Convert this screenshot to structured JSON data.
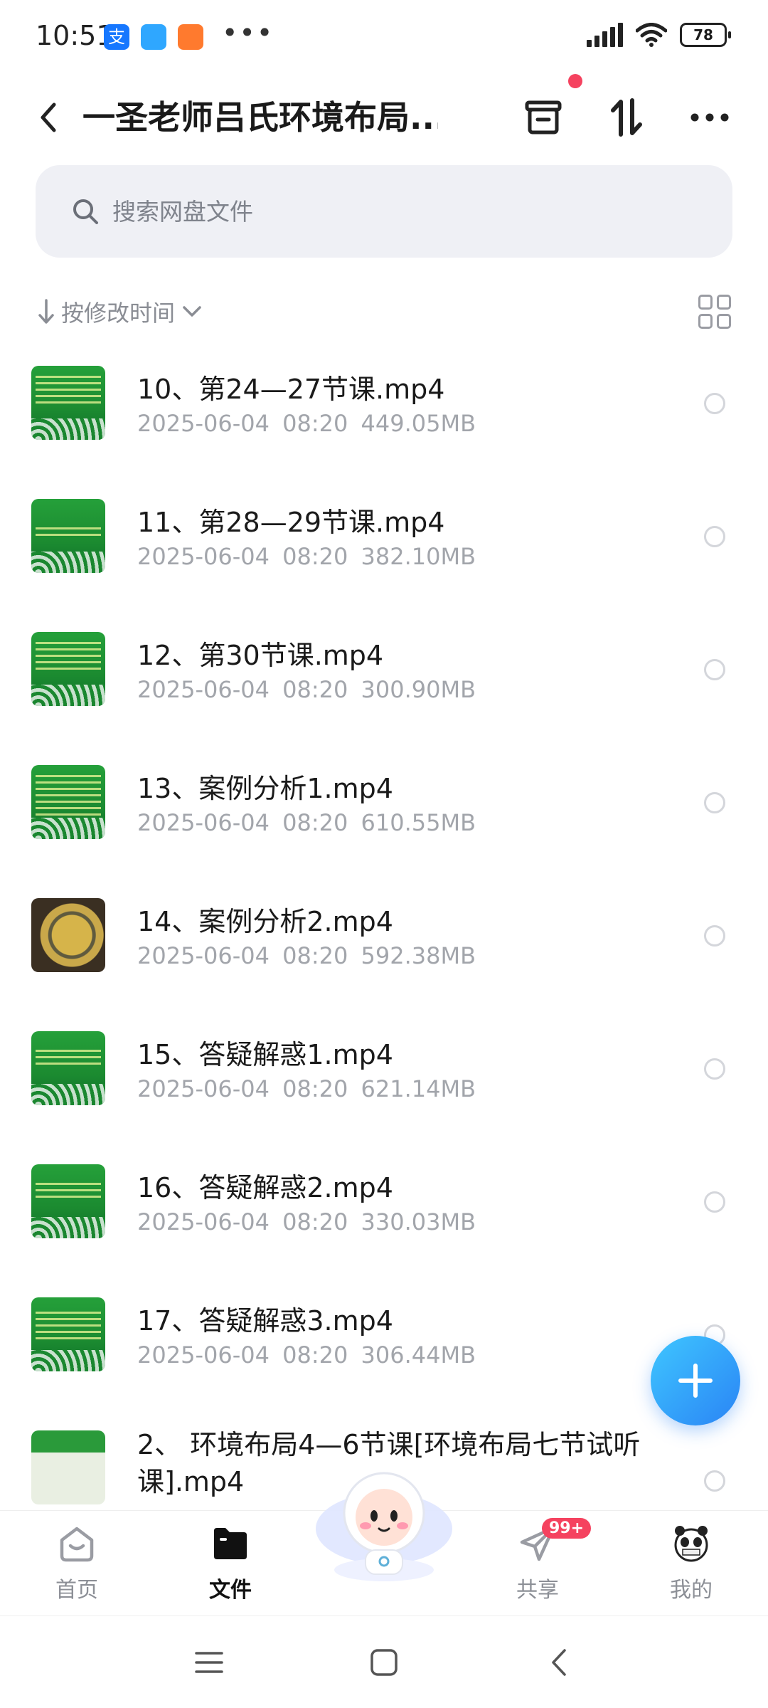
{
  "status_bar": {
    "time": "10:51",
    "overflow": "•••",
    "battery": "78"
  },
  "header": {
    "title": "一圣老师吕氏环境布局..."
  },
  "search": {
    "placeholder": "搜索网盘文件"
  },
  "sort": {
    "label": "按修改时间"
  },
  "files": [
    {
      "name": "10、第24—27节课.mp4",
      "date": "2025-06-04",
      "time": "08:20",
      "size": "449.05MB"
    },
    {
      "name": "11、第28—29节课.mp4",
      "date": "2025-06-04",
      "time": "08:20",
      "size": "382.10MB"
    },
    {
      "name": "12、第30节课.mp4",
      "date": "2025-06-04",
      "time": "08:20",
      "size": "300.90MB"
    },
    {
      "name": "13、案例分析1.mp4",
      "date": "2025-06-04",
      "time": "08:20",
      "size": "610.55MB"
    },
    {
      "name": "14、案例分析2.mp4",
      "date": "2025-06-04",
      "time": "08:20",
      "size": "592.38MB"
    },
    {
      "name": "15、答疑解惑1.mp4",
      "date": "2025-06-04",
      "time": "08:20",
      "size": "621.14MB"
    },
    {
      "name": "16、答疑解惑2.mp4",
      "date": "2025-06-04",
      "time": "08:20",
      "size": "330.03MB"
    },
    {
      "name": "17、答疑解惑3.mp4",
      "date": "2025-06-04",
      "time": "08:20",
      "size": "306.44MB"
    },
    {
      "name": "2、 环境布局4—6节课[环境布局七节试听课].mp4"
    }
  ],
  "bottom_nav": {
    "home": "首页",
    "files": "文件",
    "share": "共享",
    "share_badge": "99+",
    "me": "我的"
  },
  "colors": {
    "accent": "#2a84f5",
    "badge": "#f5425f",
    "thumb_green": "#1b8a30"
  }
}
